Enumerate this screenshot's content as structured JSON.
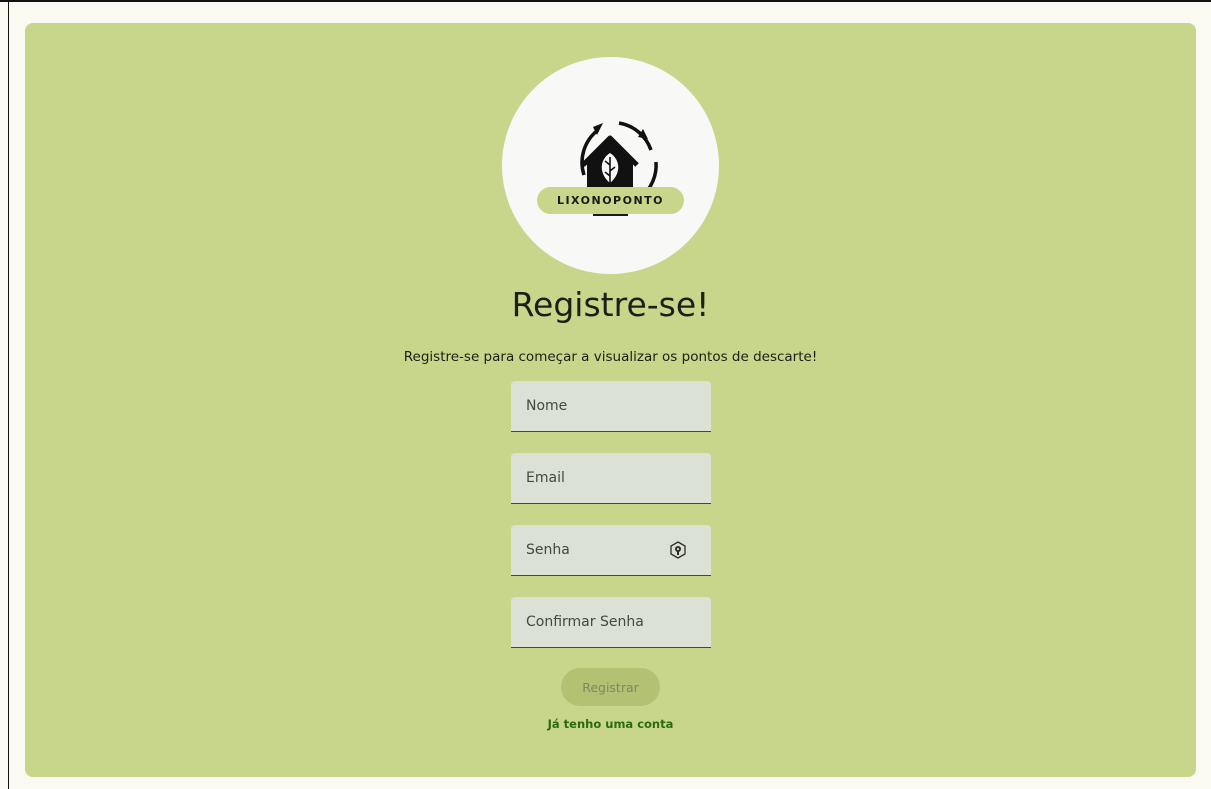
{
  "logo": {
    "brand_text": "LIXONOPONTO"
  },
  "header": {
    "title": "Registre-se!",
    "subtitle": "Registre-se para começar a visualizar os pontos de descarte!"
  },
  "form": {
    "name_placeholder": "Nome",
    "email_placeholder": "Email",
    "password_placeholder": "Senha",
    "confirm_password_placeholder": "Confirmar Senha",
    "password_toggle_icon": "visibility-toggle-icon",
    "register_label": "Registrar",
    "login_link_label": "Já tenho uma conta"
  },
  "colors": {
    "page_background": "#fafaf3",
    "card_background": "#c7d68a",
    "field_background": "#dbe1d5",
    "button_disabled_background": "#b3c173",
    "link_color": "#2a6a10"
  }
}
